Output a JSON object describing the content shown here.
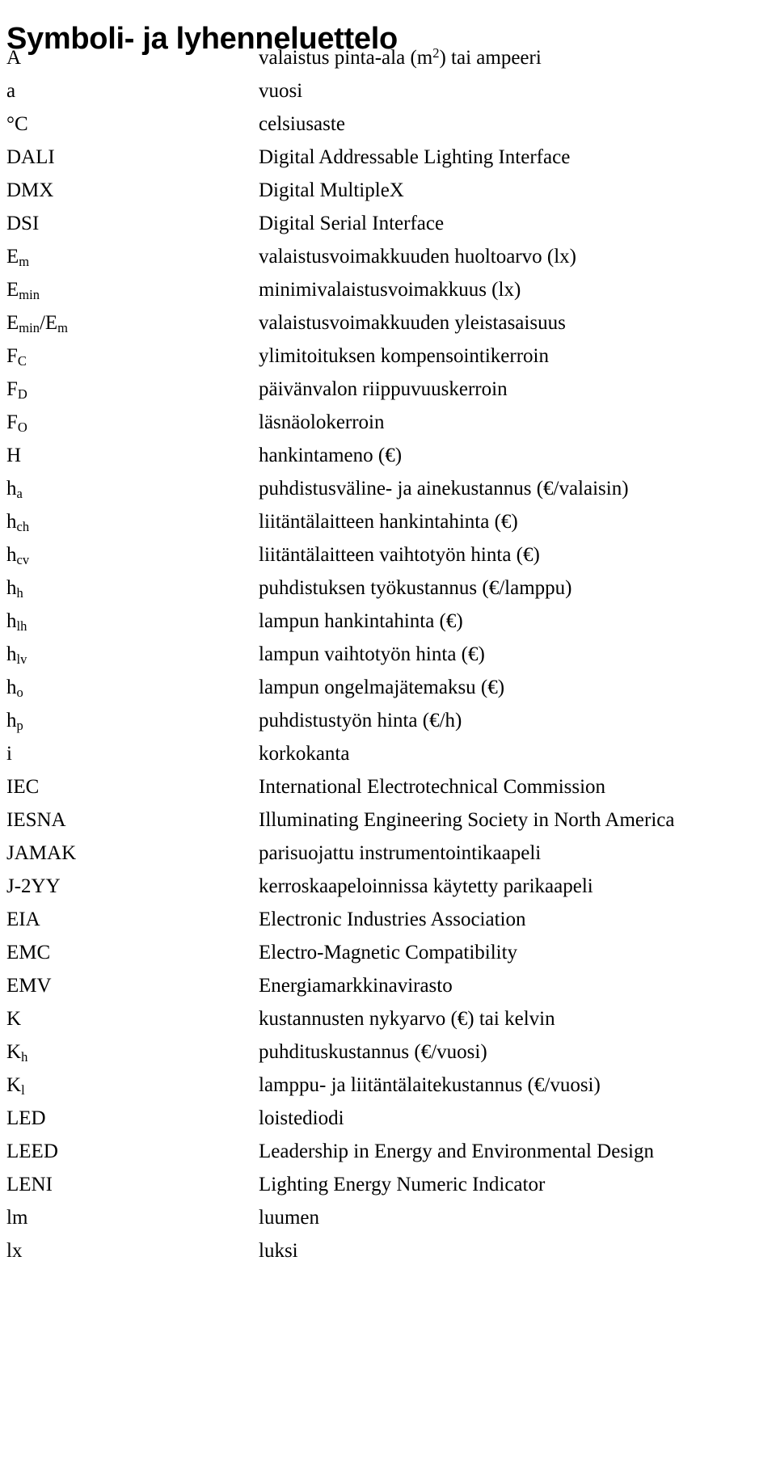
{
  "document": {
    "title": "Symboli- ja lyhenneluettelo"
  },
  "glossary": {
    "entries": [
      {
        "symbol_html": "A",
        "definition_html": "valaistus pinta-ala (m<sup>2</sup>) tai ampeeri"
      },
      {
        "symbol_html": "a",
        "definition_html": "vuosi"
      },
      {
        "symbol_html": "&deg;C",
        "definition_html": "celsiusaste"
      },
      {
        "symbol_html": "DALI",
        "definition_html": "Digital Addressable Lighting Interface"
      },
      {
        "symbol_html": "DMX",
        "definition_html": "Digital MultipleX"
      },
      {
        "symbol_html": "DSI",
        "definition_html": "Digital Serial Interface"
      },
      {
        "symbol_html": "E<sub>m</sub>",
        "definition_html": "valaistusvoimakkuuden huoltoarvo (lx)"
      },
      {
        "symbol_html": "E<sub>min</sub>",
        "definition_html": "minimivalaistusvoimakkuus (lx)"
      },
      {
        "symbol_html": "E<sub>min</sub>/E<sub>m</sub>",
        "definition_html": "valaistusvoimakkuuden yleistasaisuus"
      },
      {
        "symbol_html": "F<sub>C</sub>",
        "definition_html": "ylimitoituksen kompensointikerroin"
      },
      {
        "symbol_html": "F<sub>D</sub>",
        "definition_html": "p&auml;iv&auml;nvalon riippuvuuskerroin"
      },
      {
        "symbol_html": "F<sub>O</sub>",
        "definition_html": "l&auml;sn&auml;olokerroin"
      },
      {
        "symbol_html": "H",
        "definition_html": "hankintameno (&euro;)"
      },
      {
        "symbol_html": "h<sub>a</sub>",
        "definition_html": "puhdistusv&auml;line- ja ainekustannus (&euro;/valaisin)"
      },
      {
        "symbol_html": "h<sub>ch</sub>",
        "definition_html": "liit&auml;nt&auml;laitteen hankintahinta (&euro;)"
      },
      {
        "symbol_html": "h<sub>cv</sub>",
        "definition_html": "liit&auml;nt&auml;laitteen vaihtoty&ouml;n hinta (&euro;)"
      },
      {
        "symbol_html": "h<sub>h</sub>",
        "definition_html": "puhdistuksen ty&ouml;kustannus (&euro;/lamppu)"
      },
      {
        "symbol_html": "h<sub>lh</sub>",
        "definition_html": "lampun hankintahinta (&euro;)"
      },
      {
        "symbol_html": "h<sub>lv</sub>",
        "definition_html": "lampun vaihtoty&ouml;n hinta (&euro;)"
      },
      {
        "symbol_html": "h<sub>o</sub>",
        "definition_html": "lampun ongelmaj&auml;temaksu (&euro;)"
      },
      {
        "symbol_html": "h<sub>p</sub>",
        "definition_html": "puhdistusty&ouml;n hinta (&euro;/h)"
      },
      {
        "symbol_html": "i",
        "definition_html": "korkokanta"
      },
      {
        "symbol_html": "IEC",
        "definition_html": "International Electrotechnical Commission"
      },
      {
        "symbol_html": "IESNA",
        "definition_html": "Illuminating Engineering Society in North America"
      },
      {
        "symbol_html": "JAMAK",
        "definition_html": "parisuojattu instrumentointikaapeli"
      },
      {
        "symbol_html": "J-2YY",
        "definition_html": "kerroskaapeloinnissa k&auml;ytetty parikaapeli"
      },
      {
        "symbol_html": "EIA",
        "definition_html": "Electronic Industries Association"
      },
      {
        "symbol_html": "EMC",
        "definition_html": "Electro-Magnetic Compatibility"
      },
      {
        "symbol_html": "EMV",
        "definition_html": "Energiamarkkinavirasto"
      },
      {
        "symbol_html": "K",
        "definition_html": "kustannusten nykyarvo (&euro;) tai kelvin"
      },
      {
        "symbol_html": "K<sub>h</sub>",
        "definition_html": "puhdituskustannus (&euro;/vuosi)"
      },
      {
        "symbol_html": "K<sub>l</sub>",
        "definition_html": "lamppu- ja liit&auml;nt&auml;laitekustannus (&euro;/vuosi)"
      },
      {
        "symbol_html": "LED",
        "definition_html": "loistediodi"
      },
      {
        "symbol_html": "LEED",
        "definition_html": "Leadership in Energy and Environmental Design"
      },
      {
        "symbol_html": "LENI",
        "definition_html": "Lighting Energy Numeric Indicator"
      },
      {
        "symbol_html": "lm",
        "definition_html": "luumen"
      },
      {
        "symbol_html": "lx",
        "definition_html": "luksi"
      }
    ]
  }
}
